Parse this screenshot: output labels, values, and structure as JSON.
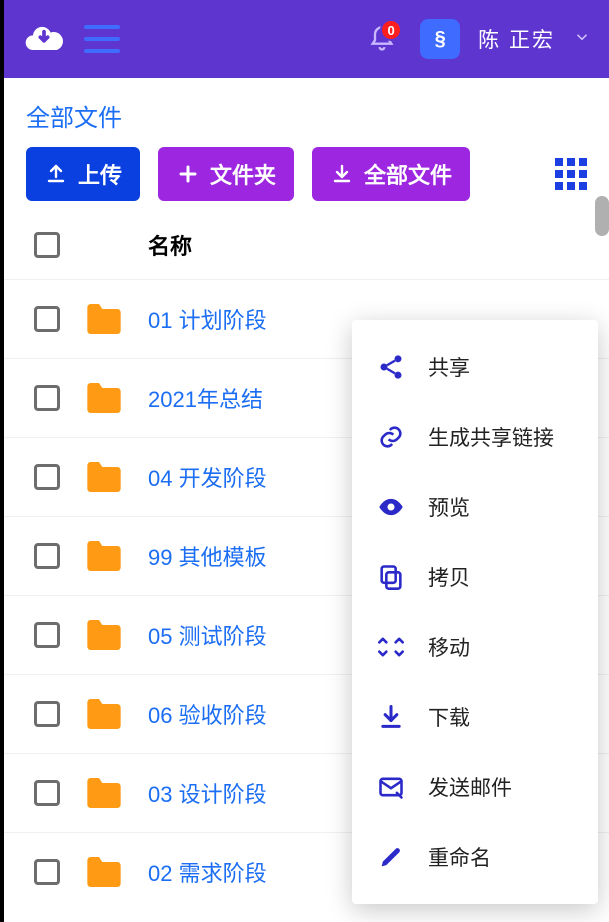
{
  "header": {
    "notification_count": "0",
    "user_name": "陈 正宏",
    "avatar_text": "§"
  },
  "breadcrumb": "全部文件",
  "toolbar": {
    "upload_label": "上传",
    "newfolder_label": "文件夹",
    "allfiles_label": "全部文件"
  },
  "list": {
    "column_name": "名称",
    "rows": [
      {
        "name": "01 计划阶段"
      },
      {
        "name": "2021年总结"
      },
      {
        "name": "04 开发阶段"
      },
      {
        "name": "99 其他模板"
      },
      {
        "name": "05 测试阶段"
      },
      {
        "name": "06 验收阶段"
      },
      {
        "name": "03 设计阶段"
      },
      {
        "name": "02 需求阶段"
      }
    ]
  },
  "context_menu": {
    "items": [
      {
        "label": "共享",
        "icon": "share"
      },
      {
        "label": "生成共享链接",
        "icon": "link"
      },
      {
        "label": "预览",
        "icon": "eye"
      },
      {
        "label": "拷贝",
        "icon": "copy"
      },
      {
        "label": "移动",
        "icon": "move"
      },
      {
        "label": "下载",
        "icon": "download"
      },
      {
        "label": "发送邮件",
        "icon": "mail"
      },
      {
        "label": "重命名",
        "icon": "rename"
      }
    ]
  },
  "colors": {
    "primary": "#5f35d0",
    "accent_blue": "#1b6ef3",
    "folder": "#ff9a14"
  }
}
